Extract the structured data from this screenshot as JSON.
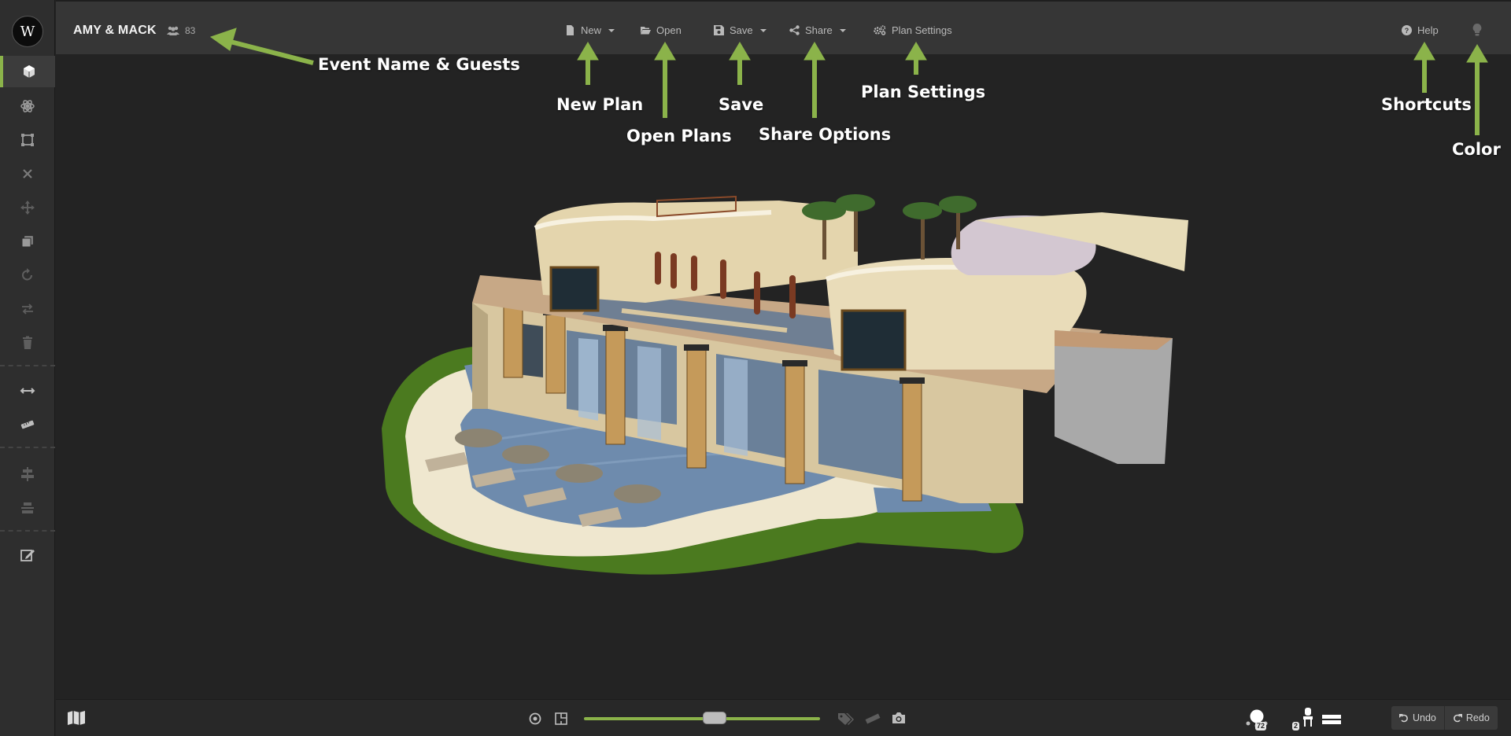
{
  "app": {
    "event_name": "AMY & MACK",
    "guest_count": "83",
    "logo_text": "W"
  },
  "menu": {
    "new_label": "New",
    "open_label": "Open",
    "save_label": "Save",
    "share_label": "Share",
    "plan_settings_label": "Plan Settings",
    "help_label": "Help"
  },
  "annotations": {
    "event_name_guests": "Event Name & Guests",
    "new_plan": "New Plan",
    "open_plans": "Open Plans",
    "save": "Save",
    "share_options": "Share Options",
    "plan_settings": "Plan Settings",
    "shortcuts": "Shortcuts",
    "color": "Color"
  },
  "sidebar": {
    "items": [
      {
        "name": "3d-view-icon",
        "active": true
      },
      {
        "name": "atom-icon"
      },
      {
        "name": "select-shape-icon"
      },
      {
        "name": "close-icon"
      },
      {
        "name": "move-icon"
      },
      {
        "name": "copy-icon"
      },
      {
        "name": "rotate-icon"
      },
      {
        "name": "swap-icon"
      },
      {
        "name": "trash-icon"
      },
      {
        "name": "measure-arrows-icon"
      },
      {
        "name": "ruler-icon"
      },
      {
        "name": "align-center-icon"
      },
      {
        "name": "distribute-icon"
      },
      {
        "name": "edit-icon"
      }
    ]
  },
  "bottombar": {
    "undo_label": "Undo",
    "redo_label": "Redo",
    "zoom_level": 0.55,
    "badge_tables": "72",
    "badge_chairs": "2"
  },
  "colors": {
    "accent": "#8bb34a",
    "topbar": "#363636",
    "sidebar": "#2e2e2e",
    "canvas": "#232323"
  }
}
